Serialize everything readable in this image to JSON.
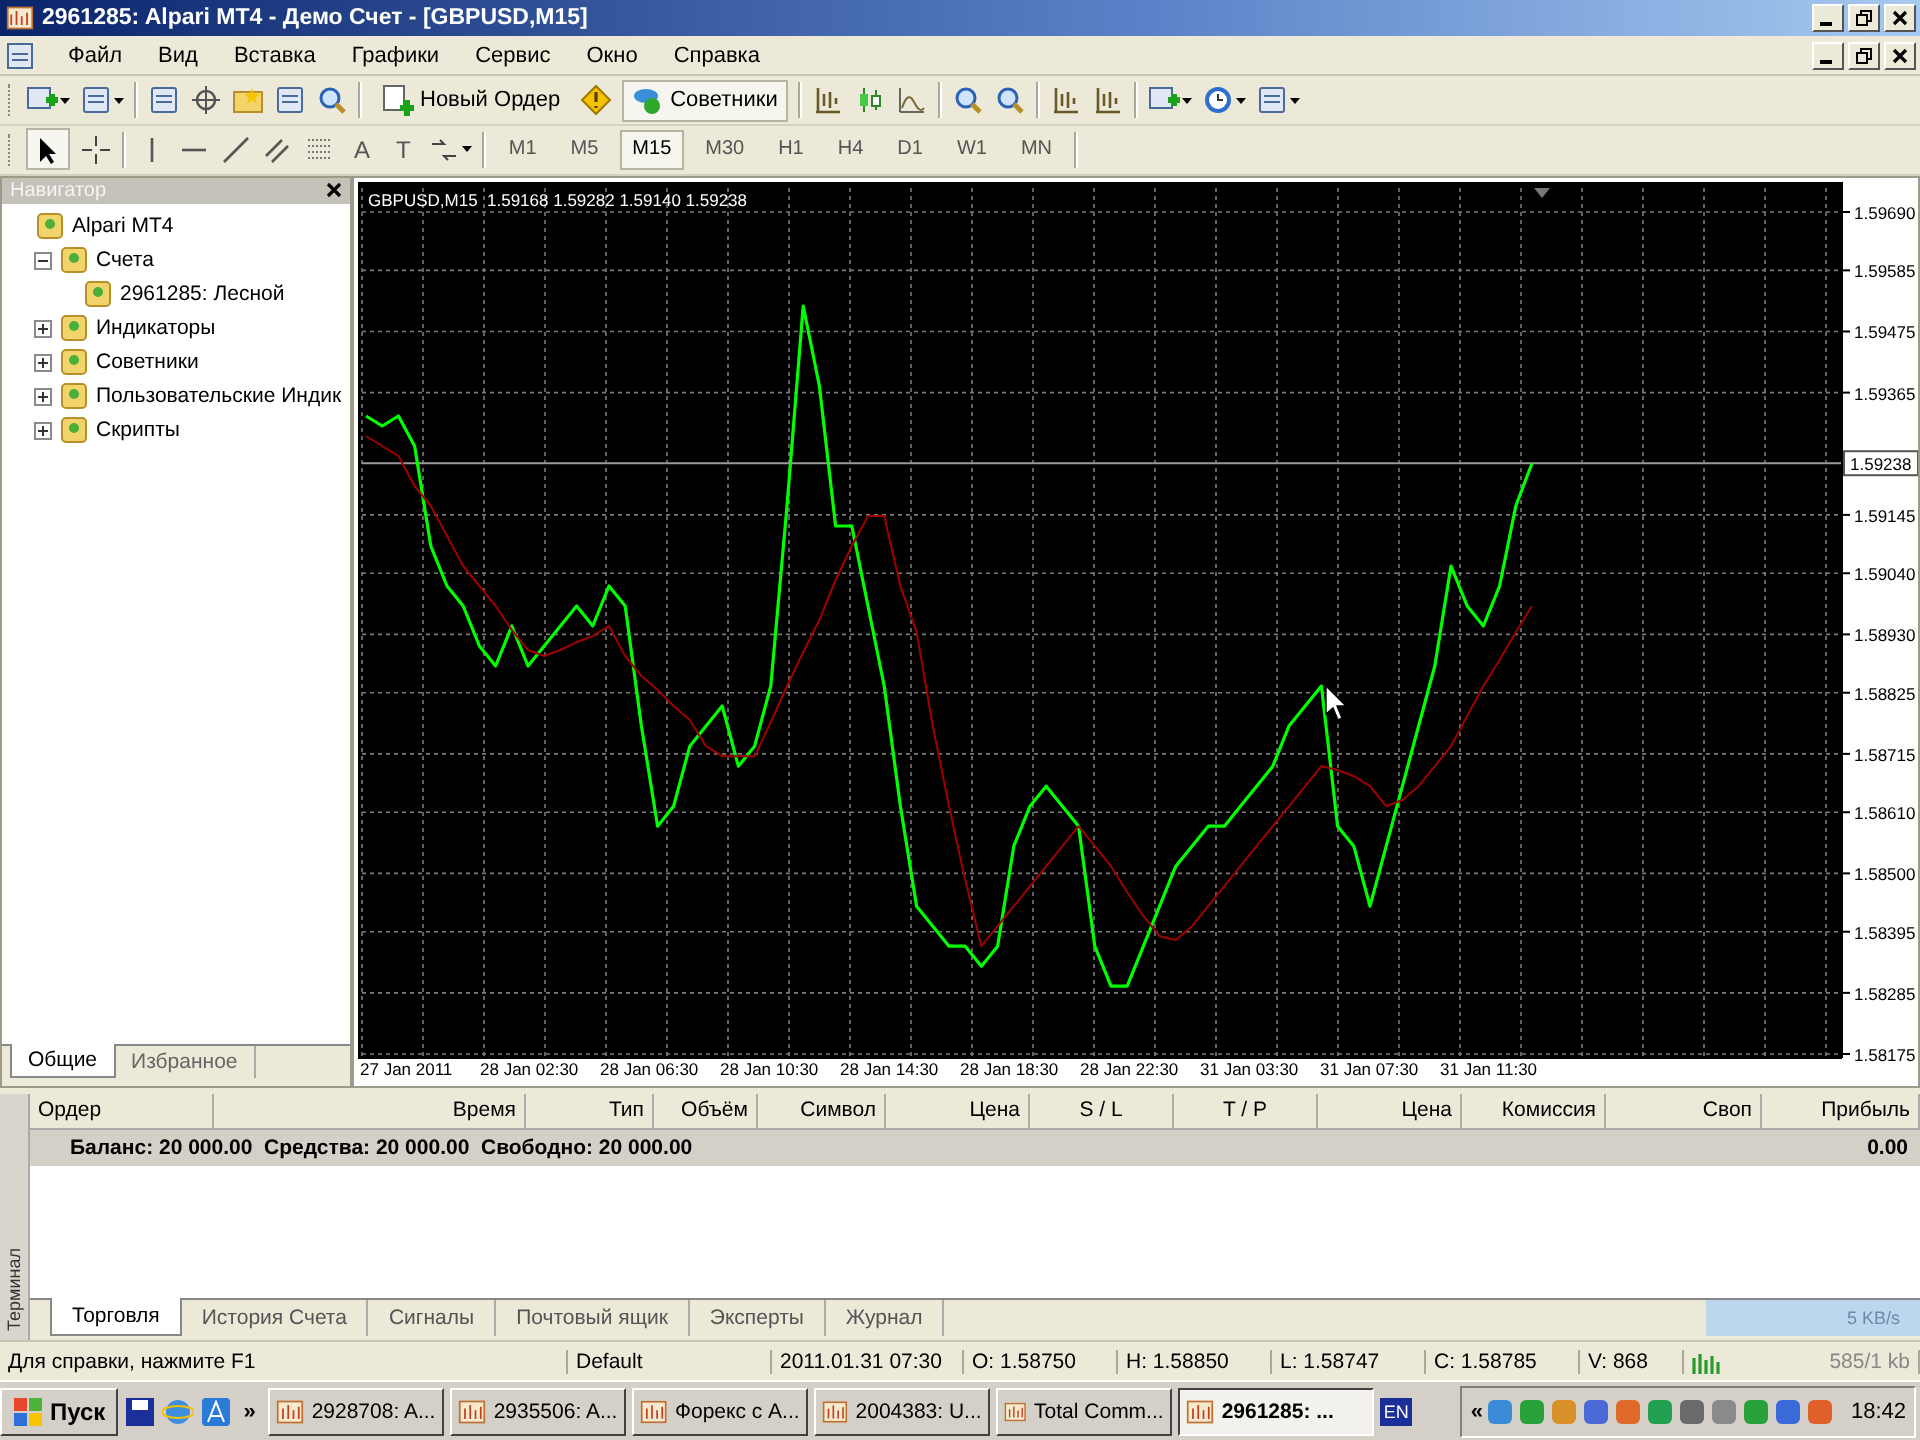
{
  "window": {
    "title": "2961285: Alpari MT4 - Демо Счет - [GBPUSD,M15]"
  },
  "menu": [
    "Файл",
    "Вид",
    "Вставка",
    "Графики",
    "Сервис",
    "Окно",
    "Справка"
  ],
  "toolbar": {
    "new_order_button": "Новый Ордер",
    "experts_button": {
      "label": "Советники",
      "on": true
    }
  },
  "drawing_toolbar": {
    "text_tool": "A",
    "label_tool": "T"
  },
  "timeframes": [
    {
      "label": "M1",
      "selected": false
    },
    {
      "label": "M5",
      "selected": false
    },
    {
      "label": "M15",
      "selected": true
    },
    {
      "label": "M30",
      "selected": false
    },
    {
      "label": "H1",
      "selected": false
    },
    {
      "label": "H4",
      "selected": false
    },
    {
      "label": "D1",
      "selected": false
    },
    {
      "label": "W1",
      "selected": false
    },
    {
      "label": "MN",
      "selected": false
    }
  ],
  "navigator": {
    "title": "Навигатор",
    "items": [
      {
        "label": "Alpari MT4",
        "children": [
          {
            "label": "Счета",
            "expanded": true,
            "children": [
              {
                "label": "2961285: Лесной"
              }
            ]
          },
          {
            "label": "Индикаторы",
            "expanded": false
          },
          {
            "label": "Советники",
            "expanded": false
          },
          {
            "label": "Пользовательские Индик",
            "expanded": false
          },
          {
            "label": "Скрипты",
            "expanded": false
          }
        ]
      }
    ],
    "tabs": [
      {
        "label": "Общие",
        "selected": true
      },
      {
        "label": "Избранное",
        "selected": false
      }
    ]
  },
  "chart": {
    "header": "GBPUSD,M15  1.59168 1.59282 1.59140 1.59238",
    "time_labels": [
      "27 Jan 2011",
      "28 Jan 02:30",
      "28 Jan 06:30",
      "28 Jan 10:30",
      "28 Jan 14:30",
      "28 Jan 18:30",
      "28 Jan 22:30",
      "31 Jan 03:30",
      "31 Jan 07:30",
      "31 Jan 11:30"
    ],
    "chart_data": {
      "type": "line",
      "grid": true,
      "ref_lines": [
        {
          "axis": "y",
          "value": 1.59238,
          "label": "1.59238"
        }
      ],
      "yticks": [
        {
          "value": 1.5969,
          "label": "1.59690"
        },
        {
          "value": 1.59585,
          "label": "1.59585"
        },
        {
          "value": 1.59475,
          "label": "1.59475"
        },
        {
          "value": 1.59365,
          "label": "1.59365"
        },
        {
          "value": 1.59145,
          "label": "1.59145"
        },
        {
          "value": 1.5904,
          "label": "1.59040"
        },
        {
          "value": 1.5893,
          "label": "1.58930"
        },
        {
          "value": 1.58825,
          "label": "1.58825"
        },
        {
          "value": 1.58715,
          "label": "1.58715"
        },
        {
          "value": 1.5861,
          "label": "1.58610"
        },
        {
          "value": 1.585,
          "label": "1.58500"
        },
        {
          "value": 1.58395,
          "label": "1.58395"
        },
        {
          "value": 1.58285,
          "label": "1.58285"
        },
        {
          "value": 1.58175,
          "label": "1.58175"
        }
      ],
      "ylim": [
        1.58175,
        1.5969
      ],
      "series": [
        {
          "color": "#00ff00",
          "values": [
            1.59323,
            1.59305,
            1.59323,
            1.59269,
            1.59089,
            1.59017,
            1.58981,
            1.58909,
            1.58873,
            1.58945,
            1.58873,
            1.58909,
            1.58945,
            1.58981,
            1.58945,
            1.59017,
            1.58981,
            1.58765,
            1.58585,
            1.58621,
            1.58729,
            1.58765,
            1.58801,
            1.58693,
            1.58729,
            1.58837,
            1.59161,
            1.59521,
            1.59377,
            1.59125,
            1.59125,
            1.58981,
            1.58837,
            1.58621,
            1.58441,
            1.58405,
            1.58369,
            1.58369,
            1.58333,
            1.58369,
            1.58549,
            1.58621,
            1.58657,
            1.58621,
            1.58585,
            1.58369,
            1.58297,
            1.58297,
            1.58369,
            1.58441,
            1.58513,
            1.58549,
            1.58585,
            1.58585,
            1.58621,
            1.58657,
            1.58693,
            1.58765,
            1.58801,
            1.58837,
            1.58585,
            1.58549,
            1.58441,
            1.58549,
            1.58657,
            1.58765,
            1.58873,
            1.59053,
            1.58981,
            1.58945,
            1.59017,
            1.59161,
            1.59238
          ]
        },
        {
          "color": "#a00000",
          "values": [
            1.59287,
            1.59269,
            1.59251,
            1.59197,
            1.59161,
            1.59107,
            1.59053,
            1.59017,
            1.58981,
            1.58938,
            1.58902,
            1.58891,
            1.58902,
            1.58916,
            1.58927,
            1.58945,
            1.58891,
            1.58855,
            1.5883,
            1.58801,
            1.58776,
            1.58729,
            1.58711,
            1.58711,
            1.58711,
            1.58772,
            1.58837,
            1.58898,
            1.58956,
            1.59028,
            1.59089,
            1.59143,
            1.59143,
            1.59017,
            1.58934,
            1.58765,
            1.58621,
            1.58488,
            1.58369,
            1.58405,
            1.58441,
            1.58477,
            1.58513,
            1.58549,
            1.58585,
            1.58549,
            1.58513,
            1.58466,
            1.58423,
            1.58387,
            1.5838,
            1.58405,
            1.58441,
            1.58477,
            1.58513,
            1.58549,
            1.58585,
            1.58621,
            1.58657,
            1.58693,
            1.58686,
            1.58675,
            1.58657,
            1.58621,
            1.58632,
            1.58657,
            1.58693,
            1.58729,
            1.58783,
            1.58837,
            1.58884,
            1.58934,
            1.58981
          ]
        }
      ]
    }
  },
  "terminal": {
    "side_label": "Терминал",
    "columns": [
      "Ордер",
      "Время",
      "Тип",
      "Объём",
      "Символ",
      "Цена",
      "S / L",
      "T / P",
      "Цена",
      "Комиссия",
      "Своп",
      "Прибыль"
    ],
    "balance_row": {
      "text": "Баланс: 20 000.00  Средства: 20 000.00  Свободно: 20 000.00",
      "profit": "0.00"
    },
    "tabs": [
      {
        "label": "Торговля",
        "selected": true
      },
      {
        "label": "История Счета",
        "selected": false
      },
      {
        "label": "Сигналы",
        "selected": false
      },
      {
        "label": "Почтовый ящик",
        "selected": false
      },
      {
        "label": "Эксперты",
        "selected": false
      },
      {
        "label": "Журнал",
        "selected": false
      }
    ],
    "speed": "5 KB/s"
  },
  "status_bar": {
    "help": "Для справки, нажмите F1",
    "profile": "Default",
    "time": "2011.01.31 07:30",
    "open": "O: 1.58750",
    "high": "H: 1.58850",
    "low": "L: 1.58747",
    "close": "C: 1.58785",
    "volume": "V: 868",
    "traffic": "585/1 kb"
  },
  "taskbar": {
    "start": "Пуск",
    "more": "»",
    "tasks": [
      {
        "label": "2928708: A...",
        "selected": false
      },
      {
        "label": "2935506: A...",
        "selected": false
      },
      {
        "label": "Форекс с А...",
        "selected": false
      },
      {
        "label": "2004383: U...",
        "selected": false
      },
      {
        "label": "Total Comm...",
        "selected": false
      },
      {
        "label": "2961285: ...",
        "selected": true
      }
    ],
    "language": "EN",
    "tray_toggle": "«",
    "clock": "18:42"
  }
}
